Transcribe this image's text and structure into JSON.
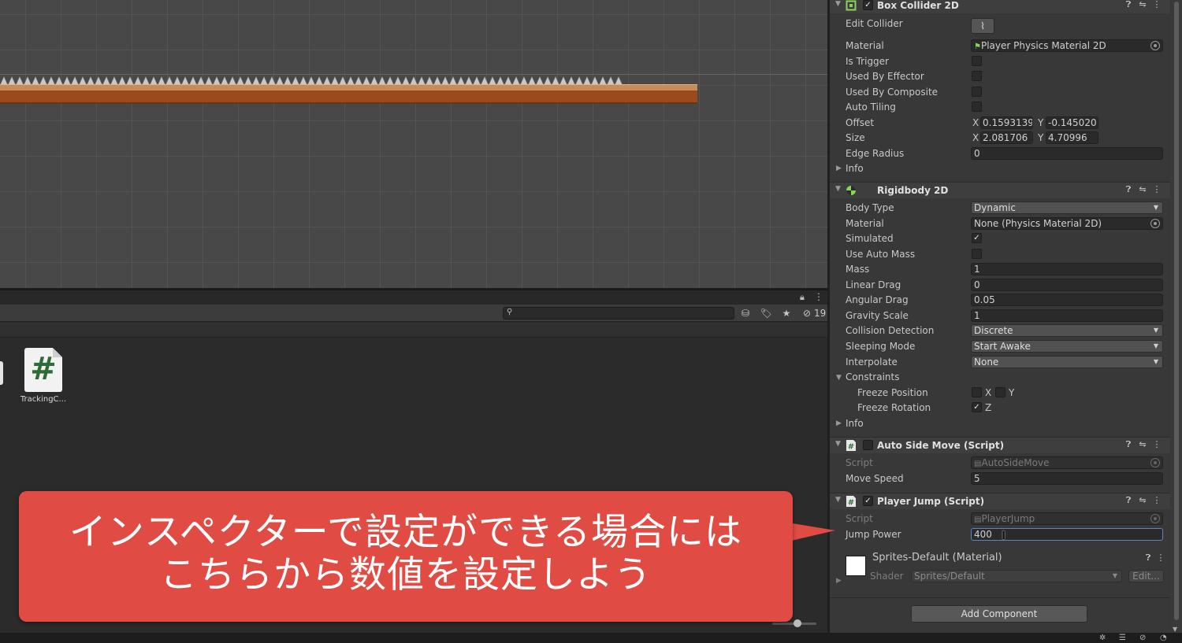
{
  "scene": {
    "spike_count": 79
  },
  "project": {
    "hidden_count": "19",
    "asset": {
      "name": "TrackingC..."
    }
  },
  "inspector": {
    "box_collider": {
      "title": "Box Collider 2D",
      "edit_collider_label": "Edit Collider",
      "material_label": "Material",
      "material_value": "Player Physics Material 2D",
      "is_trigger_label": "Is Trigger",
      "used_by_effector_label": "Used By Effector",
      "used_by_composite_label": "Used By Composite",
      "auto_tiling_label": "Auto Tiling",
      "offset_label": "Offset",
      "offset_x": "0.1593139",
      "offset_y": "-0.145020:",
      "size_label": "Size",
      "size_x": "2.081706",
      "size_y": "4.70996",
      "edge_radius_label": "Edge Radius",
      "edge_radius_value": "0",
      "info_label": "Info",
      "x_label": "X",
      "y_label": "Y"
    },
    "rigidbody": {
      "title": "Rigidbody 2D",
      "body_type_label": "Body Type",
      "body_type_value": "Dynamic",
      "material_label": "Material",
      "material_value": "None (Physics Material 2D)",
      "simulated_label": "Simulated",
      "use_auto_mass_label": "Use Auto Mass",
      "mass_label": "Mass",
      "mass_value": "1",
      "linear_drag_label": "Linear Drag",
      "linear_drag_value": "0",
      "angular_drag_label": "Angular Drag",
      "angular_drag_value": "0.05",
      "gravity_scale_label": "Gravity Scale",
      "gravity_scale_value": "1",
      "collision_detection_label": "Collision Detection",
      "collision_detection_value": "Discrete",
      "sleeping_mode_label": "Sleeping Mode",
      "sleeping_mode_value": "Start Awake",
      "interpolate_label": "Interpolate",
      "interpolate_value": "None",
      "constraints_label": "Constraints",
      "freeze_position_label": "Freeze Position",
      "freeze_rotation_label": "Freeze Rotation",
      "x_label": "X",
      "y_label": "Y",
      "z_label": "Z",
      "info_label": "Info"
    },
    "auto_side_move": {
      "title": "Auto Side Move (Script)",
      "script_label": "Script",
      "script_value": "AutoSideMove",
      "move_speed_label": "Move Speed",
      "move_speed_value": "5"
    },
    "player_jump": {
      "title": "Player Jump (Script)",
      "script_label": "Script",
      "script_value": "PlayerJump",
      "jump_power_label": "Jump Power",
      "jump_power_value": "400"
    },
    "material": {
      "name": "Sprites-Default (Material)",
      "shader_label": "Shader",
      "shader_value": "Sprites/Default",
      "edit_label": "Edit..."
    },
    "add_component_label": "Add Component"
  },
  "callout": {
    "line1": "インスペクターで設定ができる場合には",
    "line2": "こちらから数値を設定しよう"
  },
  "colors": {
    "callout": "#e04b44",
    "ground_top": "#c68c5a",
    "ground_body": "#9a4a1c",
    "script_icon": "#2f6b35"
  }
}
